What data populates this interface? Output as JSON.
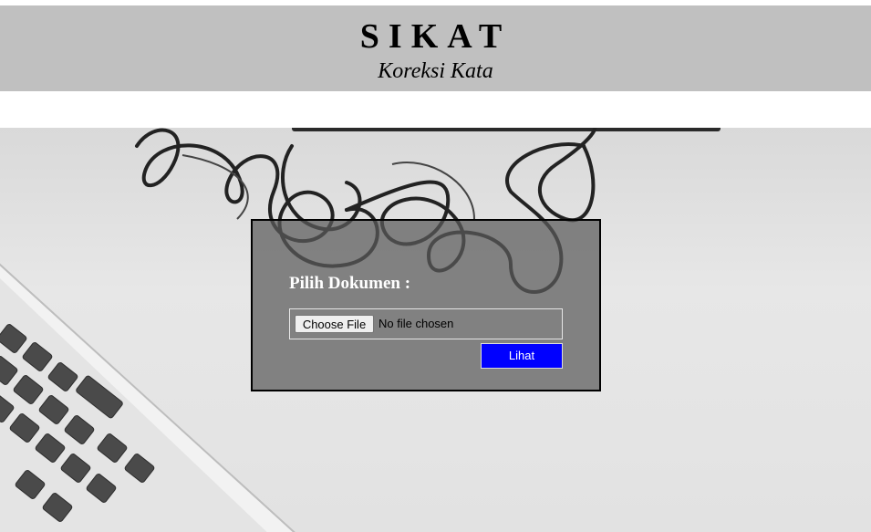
{
  "header": {
    "title": "SIKAT",
    "subtitle": "Koreksi Kata"
  },
  "form": {
    "label": "Pilih Dokumen :",
    "choose_button": "Choose File",
    "file_status": "No file chosen",
    "submit_button": "Lihat"
  },
  "colors": {
    "header_bg": "#c0c0c0",
    "submit_bg": "#0000ff"
  }
}
